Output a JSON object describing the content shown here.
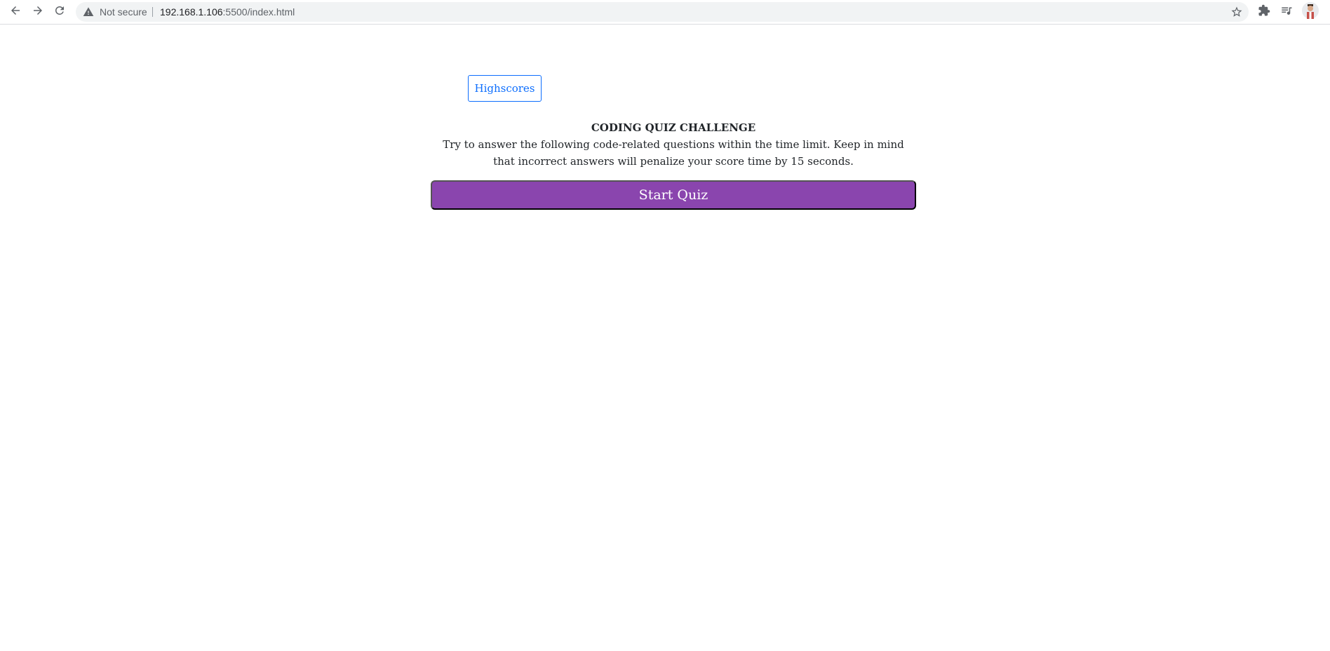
{
  "browser": {
    "security_label": "Not secure",
    "url_host": "192.168.1.106",
    "url_rest": ":5500/index.html",
    "icons": {
      "back": "arrow-left-icon",
      "forward": "arrow-right-icon",
      "reload": "reload-icon",
      "warning": "warning-triangle-icon",
      "bookmark": "star-icon",
      "extensions": "puzzle-icon",
      "media": "media-queue-icon",
      "profile": "avatar-icon"
    }
  },
  "page": {
    "highscores_label": "Highscores",
    "title": "CODING QUIZ CHALLENGE",
    "description": "Try to answer the following code-related questions within the time limit. Keep in mind that incorrect answers will penalize your score time by 15 seconds.",
    "start_label": "Start Quiz"
  },
  "colors": {
    "accent_purple": "#8a45ae",
    "link_blue": "#0d6efd"
  }
}
